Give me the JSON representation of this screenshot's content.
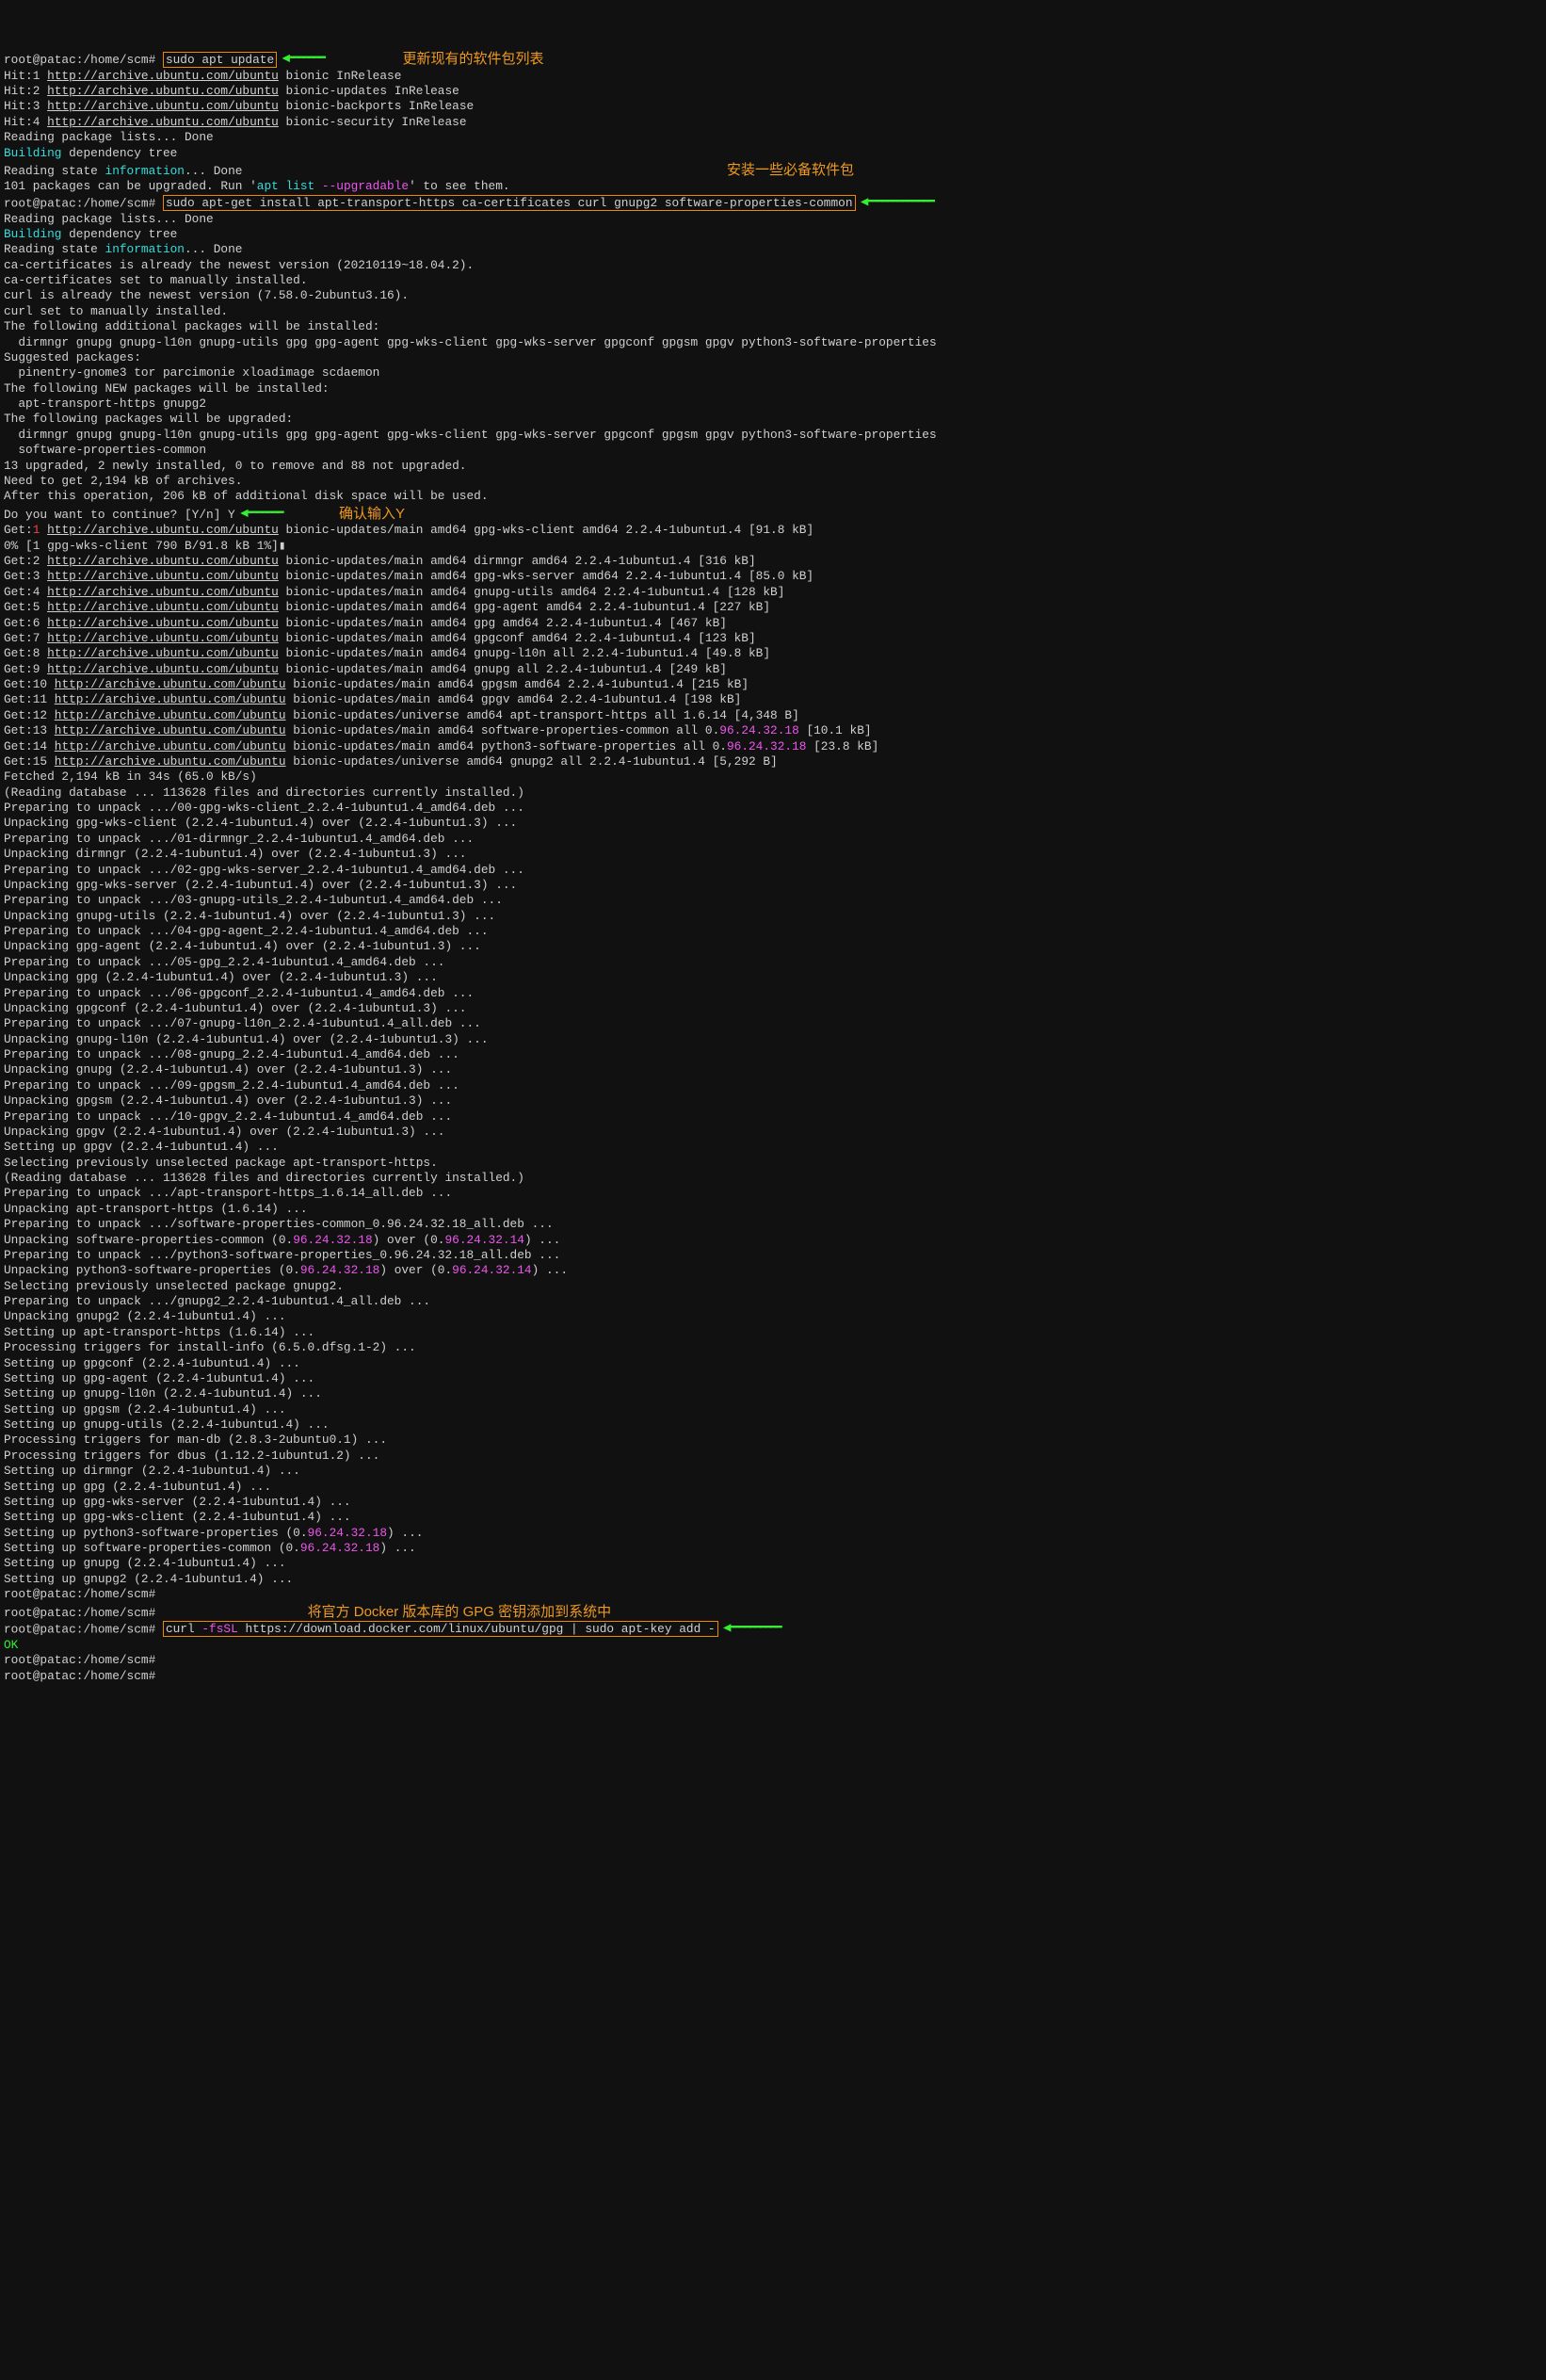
{
  "prompts": {
    "p1": "root@patac:/home/scm# ",
    "p_plain": "root@patac:/home/scm#"
  },
  "cmds": {
    "c1": "sudo apt update",
    "c2": "sudo apt-get install apt-transport-https ca-certificates curl gnupg2 software-properties-common",
    "c3_a": "curl ",
    "c3_b": "-fsSL",
    "c3_c": " https://download.docker.com/linux/ubuntu/gpg | sudo apt-key add -"
  },
  "ann": {
    "a1": "更新现有的软件包列表",
    "a2": "安装一些必备软件包",
    "a3": "确认输入Y",
    "a4": "将官方 Docker 版本库的 GPG 密钥添加到系统中"
  },
  "arrows": {
    "short": " ◀━━━━━━━",
    "long": " ◀━━━━━━━━━━━━━",
    "med": " ◀━━━━━━━━━━"
  },
  "repo_url": "http://archive.ubuntu.com/ubuntu",
  "hits": [
    "Hit:1 ",
    " bionic InRelease",
    "Hit:2 ",
    " bionic-updates InRelease",
    "Hit:3 ",
    " bionic-backports InRelease",
    "Hit:4 ",
    " bionic-security InRelease"
  ],
  "pre_lines": {
    "l1": "Reading package lists... Done",
    "l2a": "Building",
    "l2b": " dependency tree",
    "l3a": "Reading state ",
    "l3b": "information",
    "l3c": "... Done",
    "l4a": "101 packages can be upgraded. Run '",
    "l4b": "apt list ",
    "l4c": "--upgradable",
    "l4d": "' to see them."
  },
  "mid": [
    "Reading package lists... Done",
    "ca-certificates is already the newest version (20210119~18.04.2).",
    "ca-certificates set to manually installed.",
    "curl is already the newest version (7.58.0-2ubuntu3.16).",
    "curl set to manually installed.",
    "The following additional packages will be installed:",
    "  dirmngr gnupg gnupg-l10n gnupg-utils gpg gpg-agent gpg-wks-client gpg-wks-server gpgconf gpgsm gpgv python3-software-properties",
    "Suggested packages:",
    "  pinentry-gnome3 tor parcimonie xloadimage scdaemon",
    "The following NEW packages will be installed:",
    "  apt-transport-https gnupg2",
    "The following packages will be upgraded:",
    "  dirmngr gnupg gnupg-l10n gnupg-utils gpg gpg-agent gpg-wks-client gpg-wks-server gpgconf gpgsm gpgv python3-software-properties",
    "  software-properties-common",
    "13 upgraded, 2 newly installed, 0 to remove and 88 not upgraded.",
    "Need to get 2,194 kB of archives.",
    "After this operation, 206 kB of additional disk space will be used.",
    "Do you want to continue? [Y/n] Y"
  ],
  "get1": {
    "pre": "Get:",
    "num": "1",
    "sp": " ",
    "post": " bionic-updates/main amd64 gpg-wks-client amd64 2.2.4-1ubuntu1.4 [91.8 kB]",
    "progress": "0% [1 gpg-wks-client 790 B/91.8 kB 1%]▮"
  },
  "gets": [
    {
      "n": "Get:2 ",
      "post": " bionic-updates/main amd64 dirmngr amd64 2.2.4-1ubuntu1.4 [316 kB]"
    },
    {
      "n": "Get:3 ",
      "post": " bionic-updates/main amd64 gpg-wks-server amd64 2.2.4-1ubuntu1.4 [85.0 kB]"
    },
    {
      "n": "Get:4 ",
      "post": " bionic-updates/main amd64 gnupg-utils amd64 2.2.4-1ubuntu1.4 [128 kB]"
    },
    {
      "n": "Get:5 ",
      "post": " bionic-updates/main amd64 gpg-agent amd64 2.2.4-1ubuntu1.4 [227 kB]"
    },
    {
      "n": "Get:6 ",
      "post": " bionic-updates/main amd64 gpg amd64 2.2.4-1ubuntu1.4 [467 kB]"
    },
    {
      "n": "Get:7 ",
      "post": " bionic-updates/main amd64 gpgconf amd64 2.2.4-1ubuntu1.4 [123 kB]"
    },
    {
      "n": "Get:8 ",
      "post": " bionic-updates/main amd64 gnupg-l10n all 2.2.4-1ubuntu1.4 [49.8 kB]"
    },
    {
      "n": "Get:9 ",
      "post": " bionic-updates/main amd64 gnupg all 2.2.4-1ubuntu1.4 [249 kB]"
    },
    {
      "n": "Get:10 ",
      "post": " bionic-updates/main amd64 gpgsm amd64 2.2.4-1ubuntu1.4 [215 kB]"
    },
    {
      "n": "Get:11 ",
      "post": " bionic-updates/main amd64 gpgv amd64 2.2.4-1ubuntu1.4 [198 kB]"
    },
    {
      "n": "Get:12 ",
      "post": " bionic-updates/universe amd64 apt-transport-https all 1.6.14 [4,348 B]"
    }
  ],
  "gets_colored": [
    {
      "n": "Get:13 ",
      "pre": " bionic-updates/main amd64 software-properties-common all 0.",
      "ver": "96.24.32.18",
      "post": " [10.1 kB]"
    },
    {
      "n": "Get:14 ",
      "pre": " bionic-updates/main amd64 python3-software-properties all 0.",
      "ver": "96.24.32.18",
      "post": " [23.8 kB]"
    }
  ],
  "get15": {
    "n": "Get:15 ",
    "post": " bionic-updates/universe amd64 gnupg2 all 2.2.4-1ubuntu1.4 [5,292 B]"
  },
  "tail": [
    "Fetched 2,194 kB in 34s (65.0 kB/s)",
    "(Reading database ... 113628 files and directories currently installed.)",
    "Preparing to unpack .../00-gpg-wks-client_2.2.4-1ubuntu1.4_amd64.deb ...",
    "Unpacking gpg-wks-client (2.2.4-1ubuntu1.4) over (2.2.4-1ubuntu1.3) ...",
    "Preparing to unpack .../01-dirmngr_2.2.4-1ubuntu1.4_amd64.deb ...",
    "Unpacking dirmngr (2.2.4-1ubuntu1.4) over (2.2.4-1ubuntu1.3) ...",
    "Preparing to unpack .../02-gpg-wks-server_2.2.4-1ubuntu1.4_amd64.deb ...",
    "Unpacking gpg-wks-server (2.2.4-1ubuntu1.4) over (2.2.4-1ubuntu1.3) ...",
    "Preparing to unpack .../03-gnupg-utils_2.2.4-1ubuntu1.4_amd64.deb ...",
    "Unpacking gnupg-utils (2.2.4-1ubuntu1.4) over (2.2.4-1ubuntu1.3) ...",
    "Preparing to unpack .../04-gpg-agent_2.2.4-1ubuntu1.4_amd64.deb ...",
    "Unpacking gpg-agent (2.2.4-1ubuntu1.4) over (2.2.4-1ubuntu1.3) ...",
    "Preparing to unpack .../05-gpg_2.2.4-1ubuntu1.4_amd64.deb ...",
    "Unpacking gpg (2.2.4-1ubuntu1.4) over (2.2.4-1ubuntu1.3) ...",
    "Preparing to unpack .../06-gpgconf_2.2.4-1ubuntu1.4_amd64.deb ...",
    "Unpacking gpgconf (2.2.4-1ubuntu1.4) over (2.2.4-1ubuntu1.3) ...",
    "Preparing to unpack .../07-gnupg-l10n_2.2.4-1ubuntu1.4_all.deb ...",
    "Unpacking gnupg-l10n (2.2.4-1ubuntu1.4) over (2.2.4-1ubuntu1.3) ...",
    "Preparing to unpack .../08-gnupg_2.2.4-1ubuntu1.4_amd64.deb ...",
    "Unpacking gnupg (2.2.4-1ubuntu1.4) over (2.2.4-1ubuntu1.3) ...",
    "Preparing to unpack .../09-gpgsm_2.2.4-1ubuntu1.4_amd64.deb ...",
    "Unpacking gpgsm (2.2.4-1ubuntu1.4) over (2.2.4-1ubuntu1.3) ...",
    "Preparing to unpack .../10-gpgv_2.2.4-1ubuntu1.4_amd64.deb ...",
    "Unpacking gpgv (2.2.4-1ubuntu1.4) over (2.2.4-1ubuntu1.3) ...",
    "Setting up gpgv (2.2.4-1ubuntu1.4) ...",
    "Selecting previously unselected package apt-transport-https.",
    "(Reading database ... 113628 files and directories currently installed.)",
    "Preparing to unpack .../apt-transport-https_1.6.14_all.deb ...",
    "Unpacking apt-transport-https (1.6.14) ...",
    "Preparing to unpack .../software-properties-common_0.96.24.32.18_all.deb ..."
  ],
  "tail_c1": {
    "pre": "Unpacking software-properties-common (0.",
    "v1": "96.24.32.18",
    "mid": ") over (0.",
    "v2": "96.24.32.14",
    "post": ") ..."
  },
  "tail2": "Preparing to unpack .../python3-software-properties_0.96.24.32.18_all.deb ...",
  "tail_c2": {
    "pre": "Unpacking python3-software-properties (0.",
    "v1": "96.24.32.18",
    "mid": ") over (0.",
    "v2": "96.24.32.14",
    "post": ") ..."
  },
  "tail3": [
    "Selecting previously unselected package gnupg2.",
    "Preparing to unpack .../gnupg2_2.2.4-1ubuntu1.4_all.deb ...",
    "Unpacking gnupg2 (2.2.4-1ubuntu1.4) ...",
    "Setting up apt-transport-https (1.6.14) ...",
    "Processing triggers for install-info (6.5.0.dfsg.1-2) ...",
    "Setting up gpgconf (2.2.4-1ubuntu1.4) ...",
    "Setting up gpg-agent (2.2.4-1ubuntu1.4) ...",
    "Setting up gnupg-l10n (2.2.4-1ubuntu1.4) ...",
    "Setting up gpgsm (2.2.4-1ubuntu1.4) ...",
    "Setting up gnupg-utils (2.2.4-1ubuntu1.4) ...",
    "Processing triggers for man-db (2.8.3-2ubuntu0.1) ...",
    "Processing triggers for dbus (1.12.2-1ubuntu1.2) ...",
    "Setting up dirmngr (2.2.4-1ubuntu1.4) ...",
    "Setting up gpg (2.2.4-1ubuntu1.4) ...",
    "Setting up gpg-wks-server (2.2.4-1ubuntu1.4) ...",
    "Setting up gpg-wks-client (2.2.4-1ubuntu1.4) ..."
  ],
  "tail_c3": {
    "pre": "Setting up python3-software-properties (0.",
    "v": "96.24.32.18",
    "post": ") ..."
  },
  "tail_c4": {
    "pre": "Setting up software-properties-common (0.",
    "v": "96.24.32.18",
    "post": ") ..."
  },
  "tail4": [
    "Setting up gnupg (2.2.4-1ubuntu1.4) ...",
    "Setting up gnupg2 (2.2.4-1ubuntu1.4) ..."
  ],
  "ok": "OK"
}
